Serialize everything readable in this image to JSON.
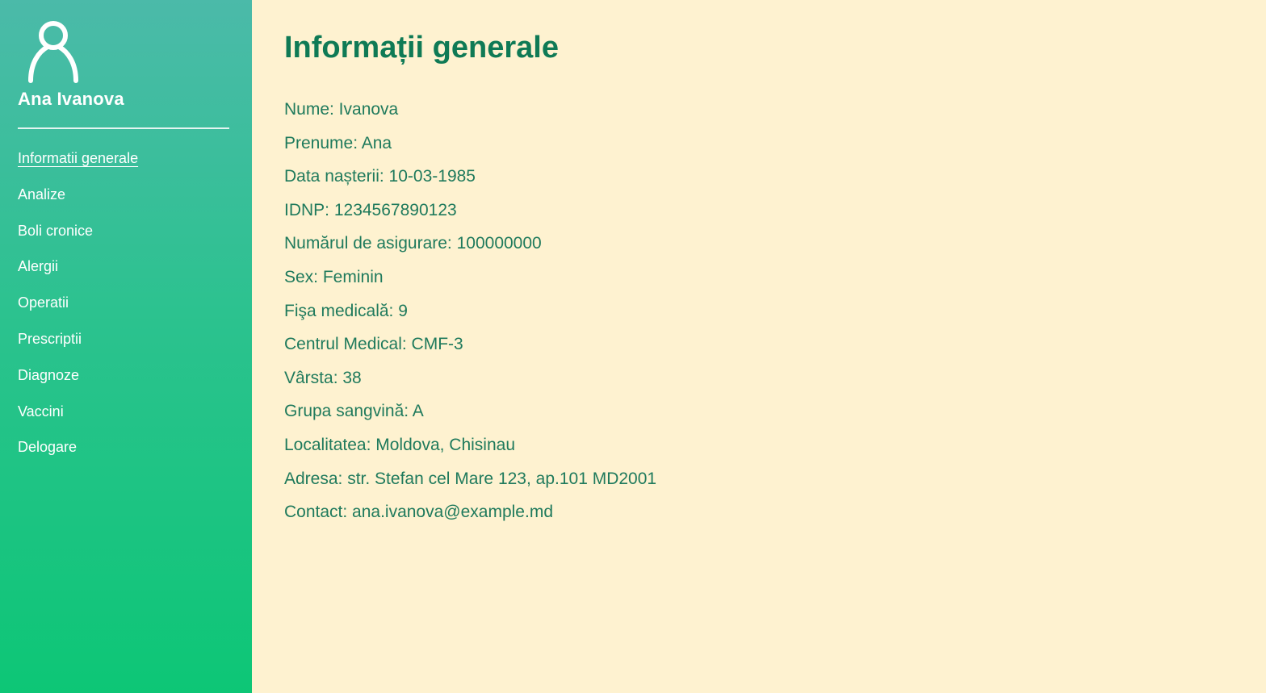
{
  "colors": {
    "sidebar_gradient_top": "#4bbaa9",
    "sidebar_gradient_bottom": "#0dc676",
    "main_background": "#fef2d0",
    "accent_text": "#0f7a55"
  },
  "sidebar": {
    "avatar_icon": "user-icon",
    "user_name": "Ana Ivanova",
    "items": [
      {
        "label": "Informatii generale",
        "active": true
      },
      {
        "label": "Analize"
      },
      {
        "label": "Boli cronice"
      },
      {
        "label": "Alergii"
      },
      {
        "label": "Operatii"
      },
      {
        "label": "Prescriptii"
      },
      {
        "label": "Diagnoze"
      },
      {
        "label": "Vaccini"
      },
      {
        "label": "Delogare"
      }
    ]
  },
  "main": {
    "title": "Informații generale",
    "fields": [
      "Nume: Ivanova",
      "Prenume: Ana",
      "Data nașterii: 10-03-1985",
      "IDNP: 1234567890123",
      "Numărul de asigurare: 100000000",
      "Sex: Feminin",
      "Fişa medicală: 9",
      "Centrul Medical: CMF-3",
      "Vârsta: 38",
      "Grupa sangvină: A",
      "Localitatea: Moldova, Chisinau",
      "Adresa: str. Stefan cel Mare 123, ap.101 MD2001",
      "Contact: ana.ivanova@example.md"
    ]
  }
}
